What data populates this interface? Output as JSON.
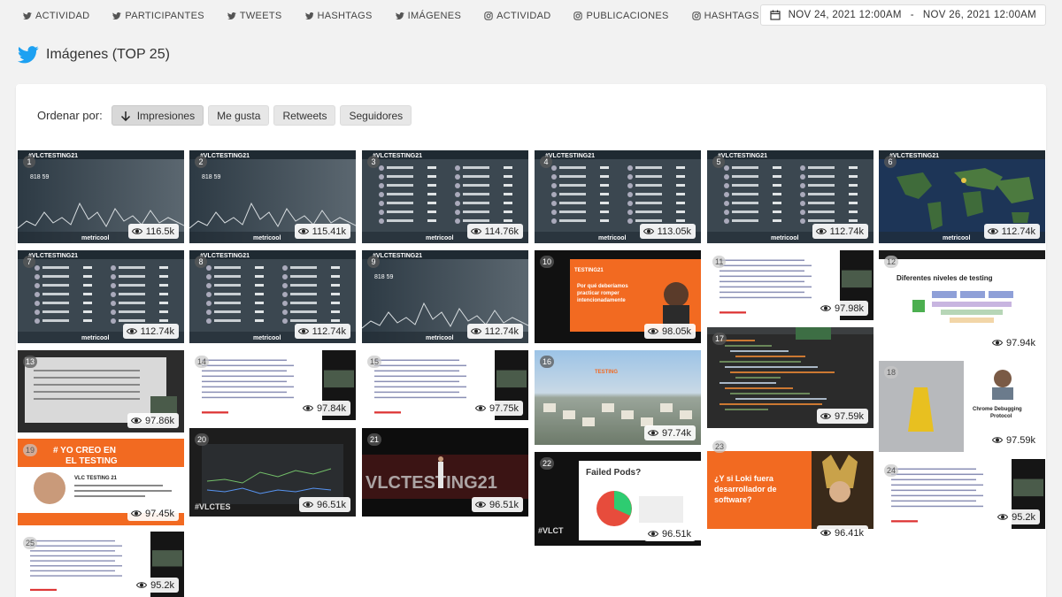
{
  "nav": {
    "items": [
      {
        "label": "ACTIVIDAD",
        "icon": "twitter-icon"
      },
      {
        "label": "PARTICIPANTES",
        "icon": "twitter-icon"
      },
      {
        "label": "TWEETS",
        "icon": "twitter-icon"
      },
      {
        "label": "HASHTAGS",
        "icon": "twitter-icon"
      },
      {
        "label": "IMÁGENES",
        "icon": "twitter-icon"
      },
      {
        "label": "ACTIVIDAD",
        "icon": "instagram-icon"
      },
      {
        "label": "PUBLICACIONES",
        "icon": "instagram-icon"
      },
      {
        "label": "HASHTAGS",
        "icon": "instagram-icon"
      }
    ],
    "date_start": "NOV 24, 2021 12:00AM",
    "date_sep": "-",
    "date_end": "NOV 26, 2021 12:00AM"
  },
  "section": {
    "title": "Imágenes (TOP 25)"
  },
  "sort": {
    "label": "Ordenar por:",
    "options": [
      "Impresiones",
      "Me gusta",
      "Retweets",
      "Seguidores"
    ],
    "active": "Impresiones"
  },
  "colors": {
    "twitter": "#1da1f2",
    "accent_orange": "#f26a21"
  },
  "images": [
    {
      "rank": "1",
      "views": "116.5k",
      "theme": "metricool"
    },
    {
      "rank": "2",
      "views": "115.41k",
      "theme": "metricool"
    },
    {
      "rank": "3",
      "views": "114.76k",
      "theme": "metricool-list"
    },
    {
      "rank": "4",
      "views": "113.05k",
      "theme": "metricool-list"
    },
    {
      "rank": "5",
      "views": "112.74k",
      "theme": "metricool-list"
    },
    {
      "rank": "6",
      "views": "112.74k",
      "theme": "map"
    },
    {
      "rank": "7",
      "views": "112.74k",
      "theme": "metricool-list"
    },
    {
      "rank": "8",
      "views": "112.74k",
      "theme": "metricool-list"
    },
    {
      "rank": "9",
      "views": "112.74k",
      "theme": "metricool"
    },
    {
      "rank": "10",
      "views": "98.05k",
      "theme": "talk-orange"
    },
    {
      "rank": "11",
      "views": "97.98k",
      "theme": "slide-white"
    },
    {
      "rank": "12",
      "views": "97.94k",
      "theme": "slide-testing"
    },
    {
      "rank": "13",
      "views": "97.86k",
      "theme": "slide-dark"
    },
    {
      "rank": "14",
      "views": "97.84k",
      "theme": "slide-white"
    },
    {
      "rank": "15",
      "views": "97.75k",
      "theme": "slide-white"
    },
    {
      "rank": "16",
      "views": "97.74k",
      "theme": "aerial"
    },
    {
      "rank": "17",
      "views": "97.59k",
      "theme": "code"
    },
    {
      "rank": "18",
      "views": "97.59k",
      "theme": "chrome"
    },
    {
      "rank": "19",
      "views": "97.45k",
      "theme": "yocreo"
    },
    {
      "rank": "20",
      "views": "96.51k",
      "theme": "dashboard"
    },
    {
      "rank": "21",
      "views": "96.51k",
      "theme": "stage"
    },
    {
      "rank": "22",
      "views": "96.51k",
      "theme": "pods"
    },
    {
      "rank": "23",
      "views": "96.41k",
      "theme": "loki"
    },
    {
      "rank": "24",
      "views": "95.2k",
      "theme": "slide-white"
    },
    {
      "rank": "25",
      "views": "95.2k",
      "theme": "slide-white"
    }
  ]
}
